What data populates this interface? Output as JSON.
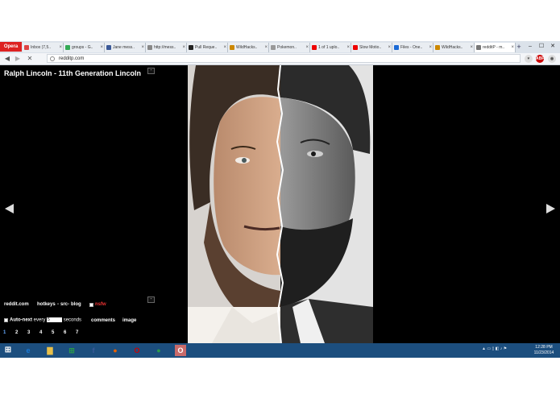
{
  "browser": {
    "brand": "Opera",
    "tabs": [
      {
        "label": "Inbox (7,5..",
        "color": "#d44"
      },
      {
        "label": "groups - G..",
        "color": "#3a5"
      },
      {
        "label": "Jane mess..",
        "color": "#3b5998"
      },
      {
        "label": "http://mess..",
        "color": "#888"
      },
      {
        "label": "Pull Reque..",
        "color": "#222"
      },
      {
        "label": "WildHacks..",
        "color": "#c80"
      },
      {
        "label": "Pokemon..",
        "color": "#999"
      },
      {
        "label": "1 of 1 uplo..",
        "color": "#e00"
      },
      {
        "label": "Slow Motio..",
        "color": "#e00"
      },
      {
        "label": "Files - One..",
        "color": "#1a6ad6"
      },
      {
        "label": "WildHacks..",
        "color": "#c80"
      },
      {
        "label": "redditP - m..",
        "color": "#777"
      }
    ],
    "new_tab_symbol": "+",
    "window_controls": [
      "–",
      "☐",
      "✕"
    ],
    "url": "redditp.com",
    "nav": {
      "back": "◀",
      "forward": "▶",
      "stop": "✕"
    },
    "right_icons": [
      {
        "name": "heart",
        "glyph": "♥",
        "color": "#555"
      },
      {
        "name": "adblock",
        "glyph": "ABP",
        "color": "#c00"
      },
      {
        "name": "menu",
        "glyph": "◉",
        "color": "#555"
      }
    ]
  },
  "viewer": {
    "title": "Ralph Lincoln - 11th Generation Lincoln",
    "collapse_symbol": "-",
    "links": {
      "reddit": "reddit.com",
      "hotkeys": "hotkeys",
      "sep1": "-",
      "src": "src",
      "sep2": "-",
      "blog": "blog",
      "nsfw": "nsfw"
    },
    "autonext": {
      "label": "Auto-next",
      "every": "every",
      "seconds_value": "5",
      "seconds_label": "seconds"
    },
    "comments": "comments",
    "image": "image",
    "pages": [
      "1",
      "2",
      "3",
      "4",
      "5",
      "6",
      "7"
    ],
    "current_page": "1"
  },
  "taskbar": {
    "apps": [
      {
        "name": "internet-explorer",
        "glyph": "e",
        "color": "#1a7ad6"
      },
      {
        "name": "file-explorer",
        "glyph": "▇",
        "color": "#e8c04a"
      },
      {
        "name": "store",
        "glyph": "⊞",
        "color": "#2a9a4a"
      },
      {
        "name": "facebook",
        "glyph": "f",
        "color": "#3b5998"
      },
      {
        "name": "firefox",
        "glyph": "●",
        "color": "#e66000"
      },
      {
        "name": "opera",
        "glyph": "O",
        "color": "#c00"
      },
      {
        "name": "chrome",
        "glyph": "●",
        "color": "#2a9a4a"
      },
      {
        "name": "opera-active",
        "glyph": "O",
        "color": "#d22"
      }
    ],
    "time": "12:28 PM",
    "date": "11/23/2014"
  }
}
